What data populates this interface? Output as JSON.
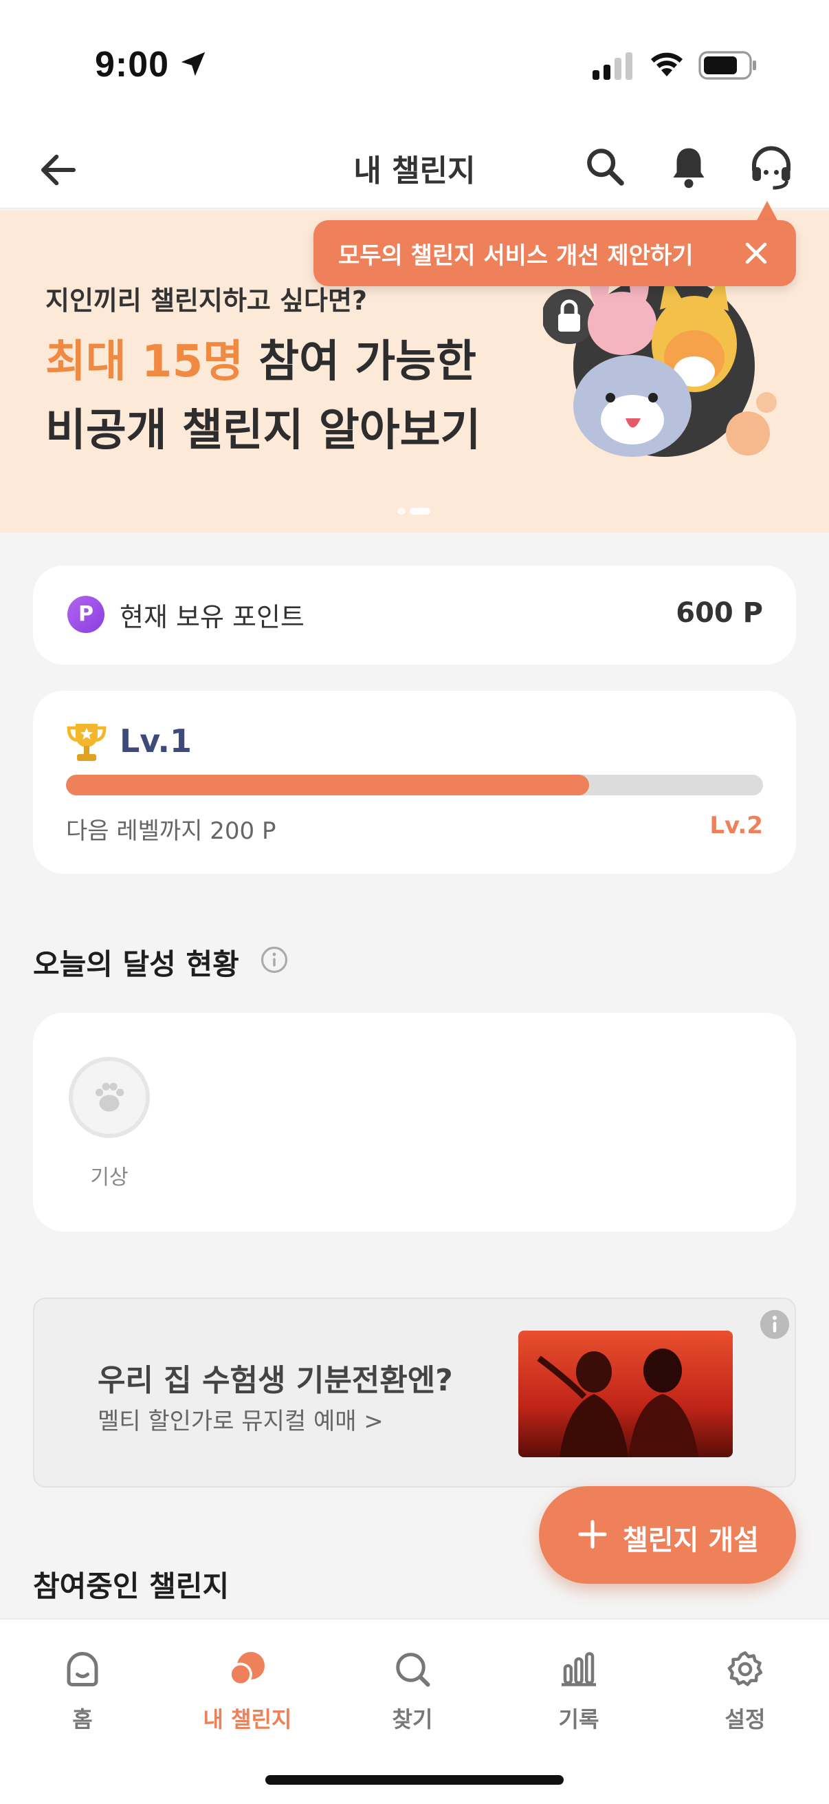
{
  "status_bar": {
    "time": "9:00"
  },
  "header": {
    "title": "내 챌린지"
  },
  "tooltip": {
    "text": "모두의 챌린지 서비스 개선 제안하기"
  },
  "banner": {
    "subtitle": "지인끼리 챌린지하고 싶다면?",
    "line1_highlight": "최대 15명",
    "line1_rest": " 참여 가능한",
    "line2": "비공개 챌린지 알아보기"
  },
  "points": {
    "badge": "P",
    "label": "현재 보유 포인트",
    "value": "600 P"
  },
  "level": {
    "current": "Lv.1",
    "progress": 0.75,
    "next_label": "다음 레벨까지 200 P",
    "next_level": "Lv.2"
  },
  "today": {
    "title": "오늘의 달성 현황",
    "items": [
      {
        "label": "기상"
      }
    ]
  },
  "ad": {
    "title": "우리 집 수험생 기분전환엔?",
    "subtitle": "멜티 할인가로 뮤지컬 예매 >"
  },
  "fab": {
    "label": "챌린지 개설"
  },
  "joined": {
    "title": "참여중인 챌린지"
  },
  "tabbar": {
    "tabs": [
      {
        "label": "홈",
        "icon": "home-icon"
      },
      {
        "label": "내 챌린지",
        "icon": "my-challenge-icon",
        "active": true
      },
      {
        "label": "찾기",
        "icon": "search-icon"
      },
      {
        "label": "기록",
        "icon": "chart-icon"
      },
      {
        "label": "설정",
        "icon": "gear-icon"
      }
    ]
  },
  "colors": {
    "accent": "#ee8159",
    "banner_bg": "#fde9d8",
    "level_text": "#3d4a7a",
    "highlight": "#f08a42"
  }
}
